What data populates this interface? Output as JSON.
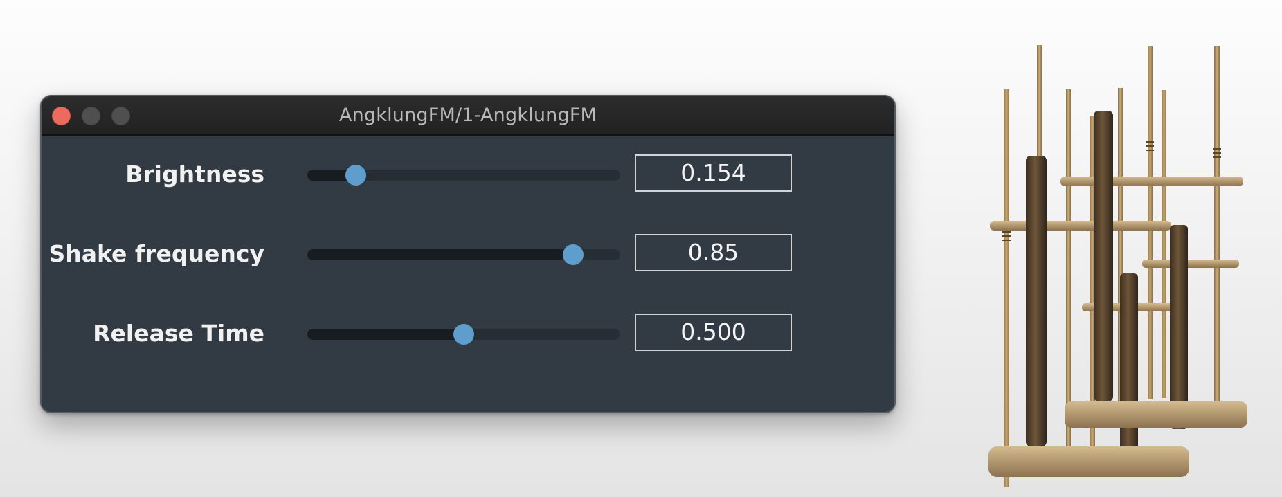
{
  "window": {
    "title": "AngklungFM/1-AngklungFM"
  },
  "params": [
    {
      "label": "Brightness",
      "value": "0.154",
      "level": 0.154
    },
    {
      "label": "Shake frequency",
      "value": "0.85",
      "level": 0.85
    },
    {
      "label": "Release Time",
      "value": "0.500",
      "level": 0.5
    }
  ],
  "colors": {
    "window_bg": "#323b44",
    "titlebar_bg": "#262626",
    "close_button": "#ec6a5e",
    "slider_thumb": "#5e9dcc",
    "slider_track": "#262d35",
    "slider_fill": "#171c21"
  },
  "image": {
    "name": "angklung-instrument"
  }
}
